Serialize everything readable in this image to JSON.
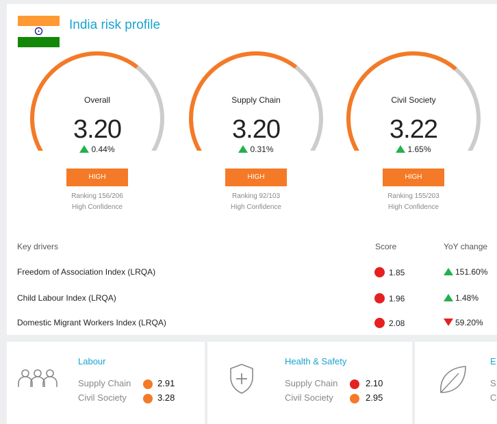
{
  "header": {
    "title": "India risk profile",
    "flag_colors": [
      "#ff9933",
      "#ffffff",
      "#138808"
    ],
    "flag_icon": "india-flag-icon"
  },
  "gauges": [
    {
      "label": "Overall",
      "score": "3.20",
      "change": "0.44%",
      "direction": "up",
      "level": "HIGH",
      "ranking": "Ranking 156/206",
      "confidence": "High Confidence",
      "fill_fraction": 0.64
    },
    {
      "label": "Supply Chain",
      "score": "3.20",
      "change": "0.31%",
      "direction": "up",
      "level": "HIGH",
      "ranking": "Ranking 92/103",
      "confidence": "High Confidence",
      "fill_fraction": 0.64
    },
    {
      "label": "Civil Society",
      "score": "3.22",
      "change": "1.65%",
      "direction": "up",
      "level": "HIGH",
      "ranking": "Ranking 155/203",
      "confidence": "High Confidence",
      "fill_fraction": 0.65
    }
  ],
  "drivers": {
    "header": {
      "name": "Key drivers",
      "score": "Score",
      "yoy": "YoY change"
    },
    "rows": [
      {
        "name": "Freedom of Association Index (LRQA)",
        "score": "1.85",
        "yoy": "151.60%",
        "direction": "up"
      },
      {
        "name": "Child Labour Index (LRQA)",
        "score": "1.96",
        "yoy": "1.48%",
        "direction": "up"
      },
      {
        "name": "Domestic Migrant Workers Index (LRQA)",
        "score": "2.08",
        "yoy": "59.20%",
        "direction": "down"
      }
    ]
  },
  "categories": [
    {
      "title": "Labour",
      "icon": "people-icon",
      "rows": [
        {
          "label": "Supply Chain",
          "value": "2.91",
          "color": "#f47a27"
        },
        {
          "label": "Civil Society",
          "value": "3.28",
          "color": "#f47a27"
        }
      ]
    },
    {
      "title": "Health & Safety",
      "icon": "shield-plus-icon",
      "rows": [
        {
          "label": "Supply Chain",
          "value": "2.10",
          "color": "#e52020"
        },
        {
          "label": "Civil Society",
          "value": "2.95",
          "color": "#f47a27"
        }
      ]
    },
    {
      "title": "E",
      "icon": "leaf-icon",
      "rows": [
        {
          "label": "S",
          "value": ""
        },
        {
          "label": "C",
          "value": ""
        }
      ]
    }
  ],
  "colors": {
    "accent": "#1aa3cf",
    "gauge_fill": "#f47a27",
    "gauge_track": "#cccccc",
    "up": "#22b14c",
    "down": "#e52020",
    "high_risk": "#e52020"
  }
}
